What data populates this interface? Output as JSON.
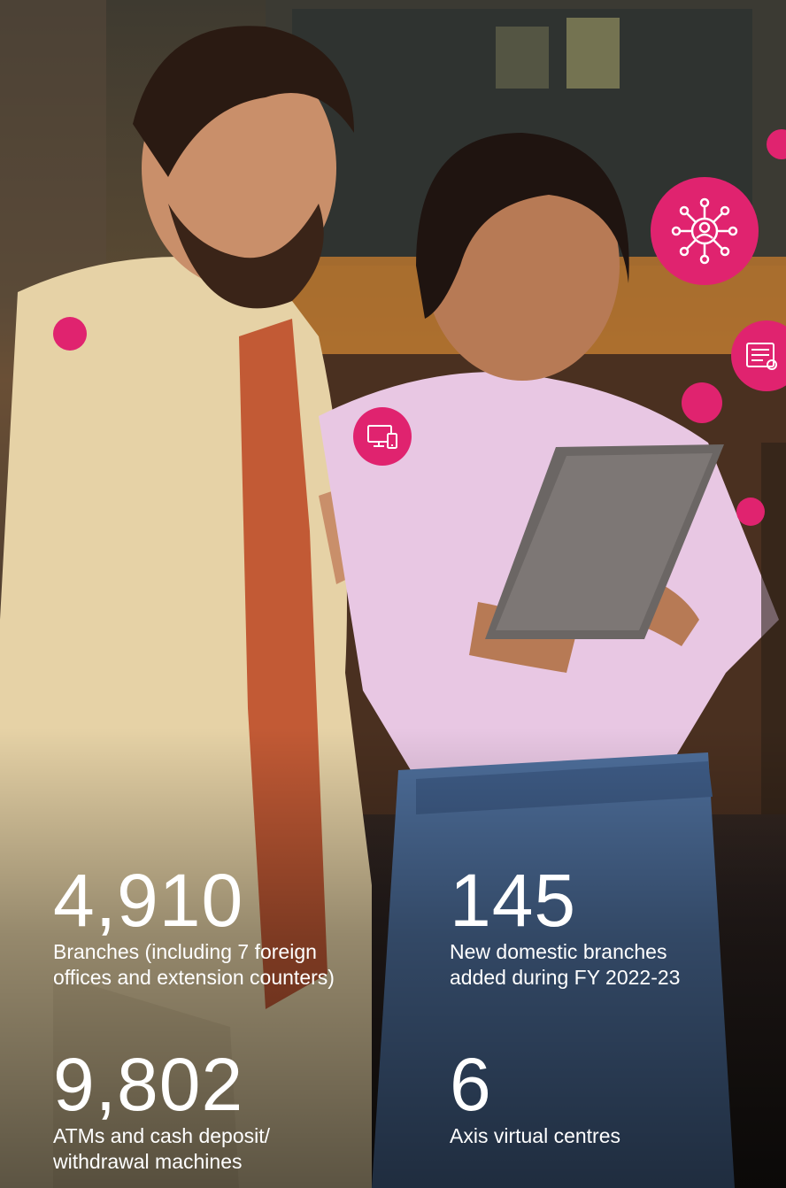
{
  "stats": [
    {
      "value": "4,910",
      "label_line1": "Branches (including 7 foreign",
      "label_line2": "offices and extension counters)"
    },
    {
      "value": "145",
      "label_line1": "New domestic branches",
      "label_line2": "added during FY 2022-23"
    },
    {
      "value": "9,802",
      "label_line1": "ATMs and cash deposit/",
      "label_line2": "withdrawal machines"
    },
    {
      "value": "6",
      "label_line1": "Axis virtual centres",
      "label_line2": ""
    }
  ],
  "colors": {
    "accent": "#e0236f",
    "text": "#ffffff"
  },
  "icons": [
    "network-user-icon",
    "devices-icon",
    "document-icon"
  ]
}
